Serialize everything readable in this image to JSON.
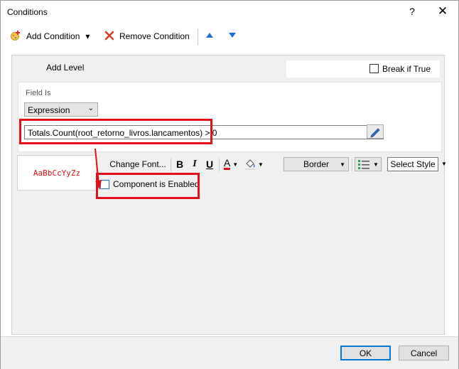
{
  "window": {
    "title": "Conditions",
    "help": "?",
    "close": "✕"
  },
  "toolbar": {
    "add_condition": "Add Condition",
    "add_dropdown": "▾",
    "remove_condition": "Remove Condition"
  },
  "condition": {
    "add_level": "Add Level",
    "break_if_true_label": "Break if True",
    "break_if_true_checked": false,
    "field_is_label": "Field Is",
    "field_is_value": "Expression",
    "expression": "Totals.Count(root_retorno_livros.lancamentos) > 0"
  },
  "format": {
    "preview_text": "AaBbCcYyZz",
    "change_font": "Change Font...",
    "bold": "B",
    "italic": "I",
    "underline": "U",
    "font_color_glyph": "A",
    "border_label": "Border",
    "select_style": "Select Style"
  },
  "component": {
    "enabled_label": "Component is Enabled",
    "enabled_checked": false
  },
  "footer": {
    "ok": "OK",
    "cancel": "Cancel"
  },
  "colors": {
    "highlight": "#e3101a",
    "preview_text": "#e01010",
    "accent": "#0078d7",
    "arrow": "#1e6fd6"
  }
}
